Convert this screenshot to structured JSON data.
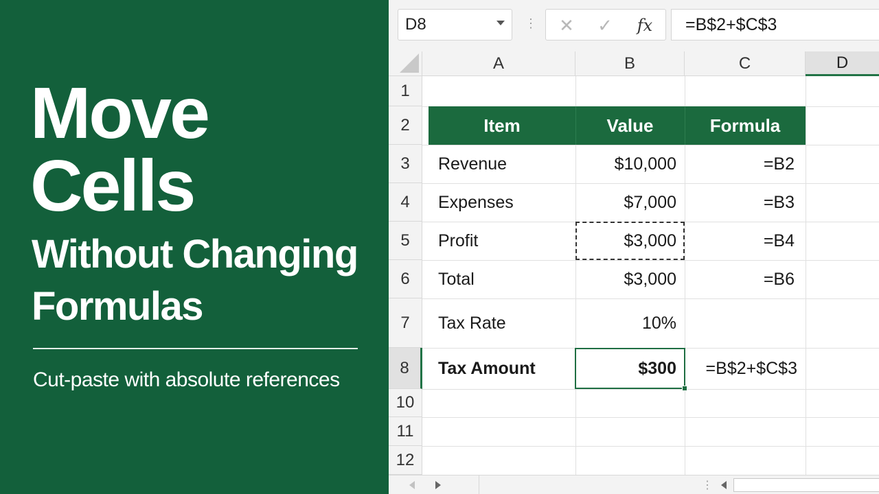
{
  "left_panel": {
    "title_line1": "Move",
    "title_line2": "Cells",
    "title_line3": "Without Changing",
    "title_line4": "Formulas",
    "subtitle": "Cut-paste with absolute references",
    "background_color": "#13603b"
  },
  "toolbar": {
    "name_box": "D8",
    "cancel_icon": "✕",
    "enter_icon": "✓",
    "fx_label": "fx",
    "formula": "=B$2+$C$3",
    "separator_dots": "⋮"
  },
  "columns": [
    "A",
    "B",
    "C",
    "D"
  ],
  "selected_column": "D",
  "rows": [
    "1",
    "2",
    "3",
    "4",
    "5",
    "6",
    "7",
    "8",
    "10",
    "11",
    "12"
  ],
  "selected_row": "8",
  "table": {
    "headers": {
      "item": "Item",
      "value": "Value",
      "formula": "Formula"
    },
    "header_color": "#1b6a3e",
    "rows": [
      {
        "item": "Revenue",
        "value": "$10,000",
        "formula": "=B2"
      },
      {
        "item": "Expenses",
        "value": "$7,000",
        "formula": "=B3"
      },
      {
        "item": "Profit",
        "value": "$3,000",
        "formula": "=B4"
      },
      {
        "item": "Total",
        "value": "$3,000",
        "formula": "=B6"
      },
      {
        "item": "Tax Rate",
        "value": "10%",
        "formula": ""
      },
      {
        "item": "Tax Amount",
        "value": "$300",
        "formula": "=B$2+$C$3"
      }
    ]
  },
  "bottom_bar": {
    "separator_dots": "⋮"
  }
}
